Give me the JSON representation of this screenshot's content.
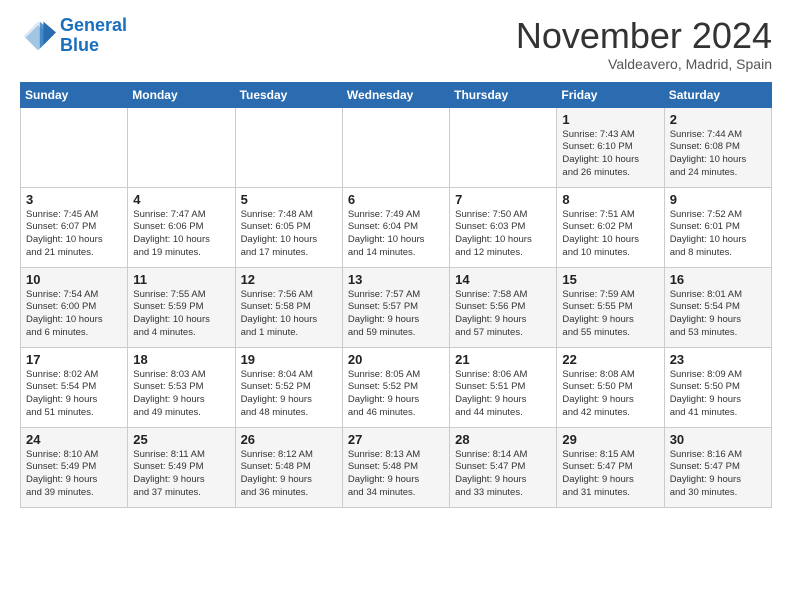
{
  "header": {
    "logo_line1": "General",
    "logo_line2": "Blue",
    "month": "November 2024",
    "location": "Valdeavero, Madrid, Spain"
  },
  "days_of_week": [
    "Sunday",
    "Monday",
    "Tuesday",
    "Wednesday",
    "Thursday",
    "Friday",
    "Saturday"
  ],
  "weeks": [
    [
      {
        "day": "",
        "info": ""
      },
      {
        "day": "",
        "info": ""
      },
      {
        "day": "",
        "info": ""
      },
      {
        "day": "",
        "info": ""
      },
      {
        "day": "",
        "info": ""
      },
      {
        "day": "1",
        "info": "Sunrise: 7:43 AM\nSunset: 6:10 PM\nDaylight: 10 hours\nand 26 minutes."
      },
      {
        "day": "2",
        "info": "Sunrise: 7:44 AM\nSunset: 6:08 PM\nDaylight: 10 hours\nand 24 minutes."
      }
    ],
    [
      {
        "day": "3",
        "info": "Sunrise: 7:45 AM\nSunset: 6:07 PM\nDaylight: 10 hours\nand 21 minutes."
      },
      {
        "day": "4",
        "info": "Sunrise: 7:47 AM\nSunset: 6:06 PM\nDaylight: 10 hours\nand 19 minutes."
      },
      {
        "day": "5",
        "info": "Sunrise: 7:48 AM\nSunset: 6:05 PM\nDaylight: 10 hours\nand 17 minutes."
      },
      {
        "day": "6",
        "info": "Sunrise: 7:49 AM\nSunset: 6:04 PM\nDaylight: 10 hours\nand 14 minutes."
      },
      {
        "day": "7",
        "info": "Sunrise: 7:50 AM\nSunset: 6:03 PM\nDaylight: 10 hours\nand 12 minutes."
      },
      {
        "day": "8",
        "info": "Sunrise: 7:51 AM\nSunset: 6:02 PM\nDaylight: 10 hours\nand 10 minutes."
      },
      {
        "day": "9",
        "info": "Sunrise: 7:52 AM\nSunset: 6:01 PM\nDaylight: 10 hours\nand 8 minutes."
      }
    ],
    [
      {
        "day": "10",
        "info": "Sunrise: 7:54 AM\nSunset: 6:00 PM\nDaylight: 10 hours\nand 6 minutes."
      },
      {
        "day": "11",
        "info": "Sunrise: 7:55 AM\nSunset: 5:59 PM\nDaylight: 10 hours\nand 4 minutes."
      },
      {
        "day": "12",
        "info": "Sunrise: 7:56 AM\nSunset: 5:58 PM\nDaylight: 10 hours\nand 1 minute."
      },
      {
        "day": "13",
        "info": "Sunrise: 7:57 AM\nSunset: 5:57 PM\nDaylight: 9 hours\nand 59 minutes."
      },
      {
        "day": "14",
        "info": "Sunrise: 7:58 AM\nSunset: 5:56 PM\nDaylight: 9 hours\nand 57 minutes."
      },
      {
        "day": "15",
        "info": "Sunrise: 7:59 AM\nSunset: 5:55 PM\nDaylight: 9 hours\nand 55 minutes."
      },
      {
        "day": "16",
        "info": "Sunrise: 8:01 AM\nSunset: 5:54 PM\nDaylight: 9 hours\nand 53 minutes."
      }
    ],
    [
      {
        "day": "17",
        "info": "Sunrise: 8:02 AM\nSunset: 5:54 PM\nDaylight: 9 hours\nand 51 minutes."
      },
      {
        "day": "18",
        "info": "Sunrise: 8:03 AM\nSunset: 5:53 PM\nDaylight: 9 hours\nand 49 minutes."
      },
      {
        "day": "19",
        "info": "Sunrise: 8:04 AM\nSunset: 5:52 PM\nDaylight: 9 hours\nand 48 minutes."
      },
      {
        "day": "20",
        "info": "Sunrise: 8:05 AM\nSunset: 5:52 PM\nDaylight: 9 hours\nand 46 minutes."
      },
      {
        "day": "21",
        "info": "Sunrise: 8:06 AM\nSunset: 5:51 PM\nDaylight: 9 hours\nand 44 minutes."
      },
      {
        "day": "22",
        "info": "Sunrise: 8:08 AM\nSunset: 5:50 PM\nDaylight: 9 hours\nand 42 minutes."
      },
      {
        "day": "23",
        "info": "Sunrise: 8:09 AM\nSunset: 5:50 PM\nDaylight: 9 hours\nand 41 minutes."
      }
    ],
    [
      {
        "day": "24",
        "info": "Sunrise: 8:10 AM\nSunset: 5:49 PM\nDaylight: 9 hours\nand 39 minutes."
      },
      {
        "day": "25",
        "info": "Sunrise: 8:11 AM\nSunset: 5:49 PM\nDaylight: 9 hours\nand 37 minutes."
      },
      {
        "day": "26",
        "info": "Sunrise: 8:12 AM\nSunset: 5:48 PM\nDaylight: 9 hours\nand 36 minutes."
      },
      {
        "day": "27",
        "info": "Sunrise: 8:13 AM\nSunset: 5:48 PM\nDaylight: 9 hours\nand 34 minutes."
      },
      {
        "day": "28",
        "info": "Sunrise: 8:14 AM\nSunset: 5:47 PM\nDaylight: 9 hours\nand 33 minutes."
      },
      {
        "day": "29",
        "info": "Sunrise: 8:15 AM\nSunset: 5:47 PM\nDaylight: 9 hours\nand 31 minutes."
      },
      {
        "day": "30",
        "info": "Sunrise: 8:16 AM\nSunset: 5:47 PM\nDaylight: 9 hours\nand 30 minutes."
      }
    ]
  ]
}
